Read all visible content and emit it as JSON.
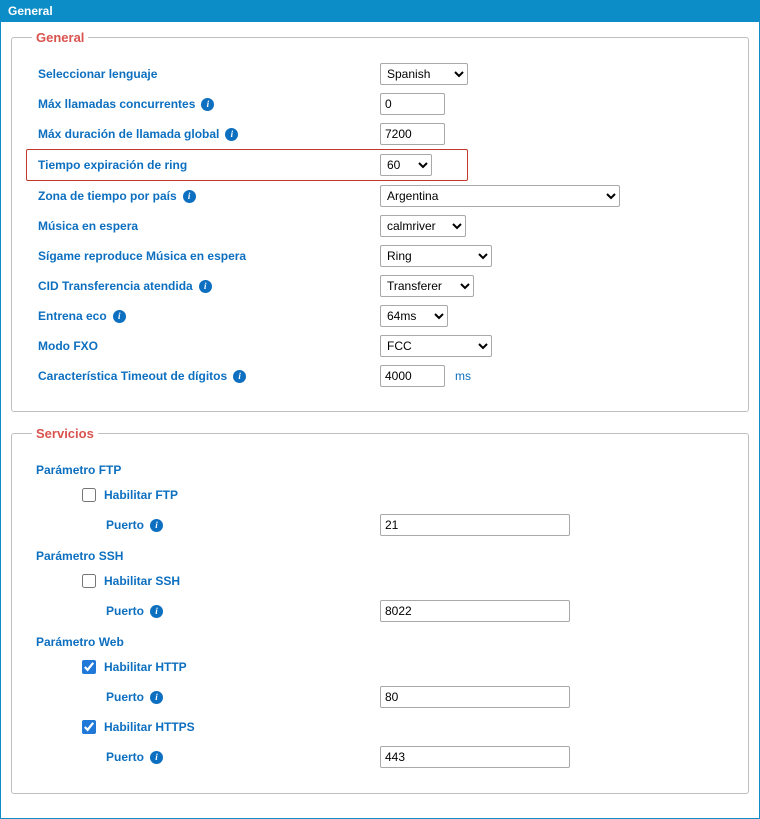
{
  "header": {
    "title": "General"
  },
  "general": {
    "legend": "General",
    "language": {
      "label": "Seleccionar lenguaje",
      "value": "Spanish"
    },
    "max_concurrent": {
      "label": "Máx llamadas concurrentes",
      "value": "0"
    },
    "max_duration": {
      "label": "Máx duración de llamada global",
      "value": "7200"
    },
    "ring_timeout": {
      "label": "Tiempo expiración de ring",
      "value": "60"
    },
    "timezone": {
      "label": "Zona de tiempo por país",
      "value": "Argentina"
    },
    "moh": {
      "label": "Música en espera",
      "value": "calmriver"
    },
    "followme": {
      "label": "Sígame reproduce Música en espera",
      "value": "Ring"
    },
    "cid_transfer": {
      "label": "CID Transferencia atendida",
      "value": "Transferer"
    },
    "echo": {
      "label": "Entrena eco",
      "value": "64ms"
    },
    "fxo": {
      "label": "Modo FXO",
      "value": "FCC"
    },
    "digit_timeout": {
      "label": "Característica Timeout de dígitos",
      "value": "4000",
      "suffix": "ms"
    }
  },
  "services": {
    "legend": "Servicios",
    "port_label": "Puerto",
    "ftp": {
      "heading": "Parámetro FTP",
      "enable_label": "Habilitar FTP",
      "enabled": false,
      "port": "21"
    },
    "ssh": {
      "heading": "Parámetro SSH",
      "enable_label": "Habilitar SSH",
      "enabled": false,
      "port": "8022"
    },
    "web": {
      "heading": "Parámetro Web",
      "http": {
        "enable_label": "Habilitar HTTP",
        "enabled": true,
        "port": "80"
      },
      "https": {
        "enable_label": "Habilitar HTTPS",
        "enabled": true,
        "port": "443"
      }
    }
  }
}
